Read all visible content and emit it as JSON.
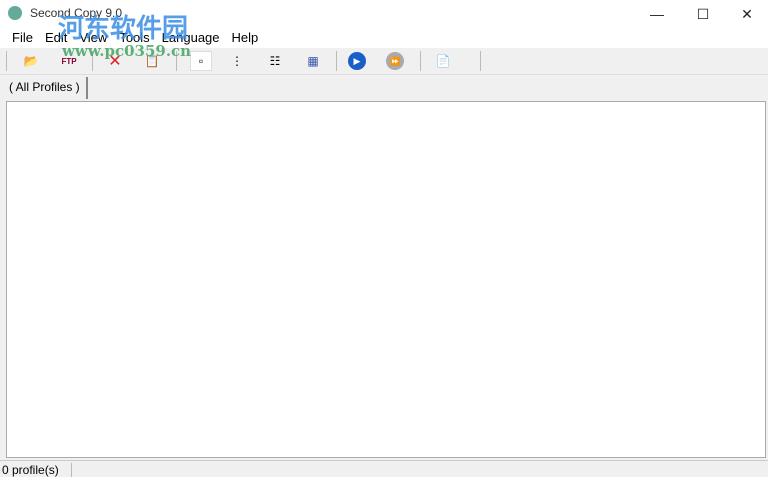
{
  "window": {
    "title": "Second Copy 9.0"
  },
  "menu": [
    "File",
    "Edit",
    "View",
    "Tools",
    "Language",
    "Help"
  ],
  "toolbar": [
    {
      "icon": "new-profile-icon",
      "glyph": "📂"
    },
    {
      "icon": "ftp-icon",
      "glyph": "FTP"
    },
    {
      "icon": "delete-icon",
      "glyph": "✕"
    },
    {
      "icon": "properties-icon",
      "glyph": "📋"
    },
    {
      "icon": "view-icons-icon",
      "glyph": "▫"
    },
    {
      "icon": "view-tree-icon",
      "glyph": "⋮"
    },
    {
      "icon": "view-list-icon",
      "glyph": "☷"
    },
    {
      "icon": "view-details-icon",
      "glyph": "▦"
    },
    {
      "icon": "run-icon",
      "glyph": "▶"
    },
    {
      "icon": "run-all-icon",
      "glyph": "⏩"
    },
    {
      "icon": "log-icon",
      "glyph": "📄"
    }
  ],
  "tabs": [
    "(  All Profiles  )"
  ],
  "status": {
    "count": "0 profile(s)"
  },
  "watermark": {
    "cn": "河东软件园",
    "url": "www.pc0359.cn"
  }
}
